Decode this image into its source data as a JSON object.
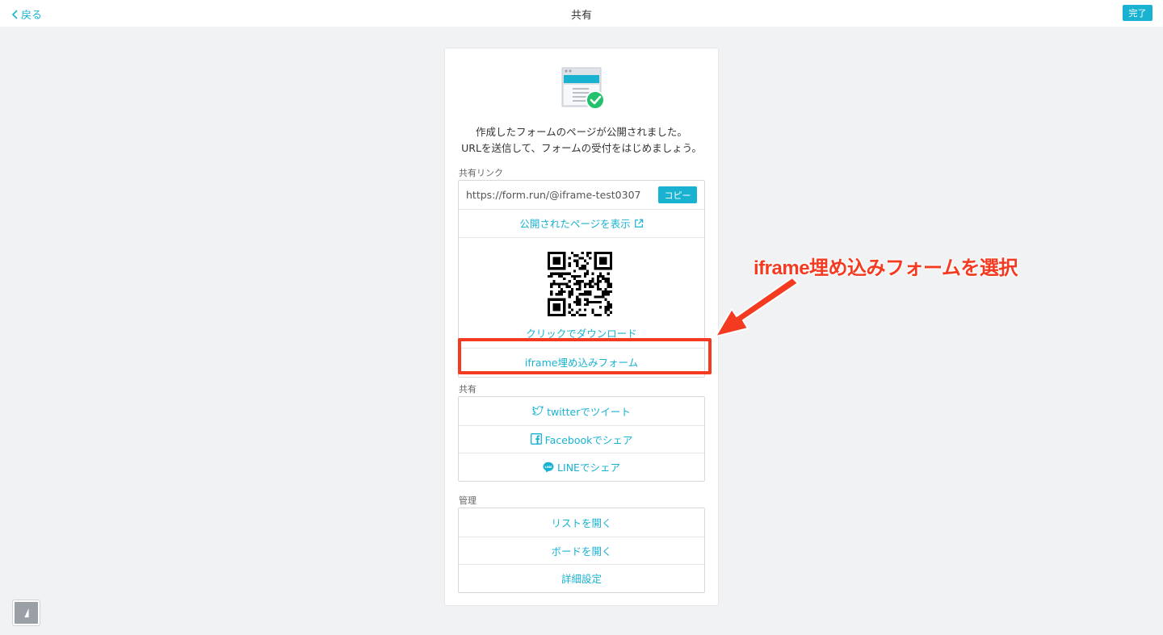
{
  "header": {
    "back_label": "戻る",
    "title": "共有",
    "done_label": "完了"
  },
  "card": {
    "intro_line1": "作成したフォームのページが公開されました。",
    "intro_line2": "URLを送信して、フォームの受付をはじめましょう。",
    "share_link_label": "共有リンク",
    "url": "https://form.run/@iframe-test0307",
    "copy_label": "コピー",
    "view_page_label": "公開されたページを表示",
    "qr_download_label": "クリックでダウンロード",
    "iframe_label": "iframe埋め込みフォーム",
    "share_label": "共有",
    "twitter_label": "twitterでツイート",
    "facebook_label": "Facebookでシェア",
    "line_label": "LINEでシェア",
    "manage_label": "管理",
    "open_list_label": "リストを開く",
    "open_board_label": "ボードを開く",
    "settings_label": "詳細設定"
  },
  "annotation": {
    "callout_text": "iframe埋め込みフォームを選択"
  },
  "colors": {
    "accent": "#1ab2d1",
    "highlight": "#f43a21",
    "success": "#21c26b"
  }
}
